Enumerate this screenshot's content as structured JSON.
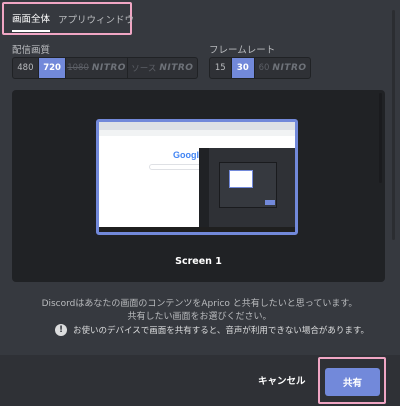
{
  "tabs": [
    {
      "label": "画面全体",
      "active": true
    },
    {
      "label": "アプリウィンドウ",
      "active": false
    }
  ],
  "quality": {
    "label": "配信画質",
    "options": [
      {
        "label": "480"
      },
      {
        "label": "720",
        "selected": true
      },
      {
        "label": "1080",
        "nitro": "NITRO"
      },
      {
        "label": "ソース",
        "nitro": "NITRO"
      }
    ]
  },
  "framerate": {
    "label": "フレームレート",
    "options": [
      {
        "label": "15"
      },
      {
        "label": "30",
        "selected": true
      },
      {
        "label": "60",
        "nitro": "NITRO"
      }
    ]
  },
  "preview": {
    "screen_name": "Screen 1",
    "google_logo": "Google"
  },
  "description": {
    "line1": "Discordはあなたの画面のコンテンツをAprico と共有したいと思っています。",
    "line2": "共有したい画面をお選びください。"
  },
  "warning": {
    "icon": "!",
    "text": "お使いのデバイスで画面を共有すると、音声が利用できない場合があります。"
  },
  "footer": {
    "cancel_label": "キャンセル",
    "share_label": "共有"
  },
  "colors": {
    "accent": "#7289da",
    "highlight_outline": "#f0a6c4",
    "background": "#36393f"
  }
}
